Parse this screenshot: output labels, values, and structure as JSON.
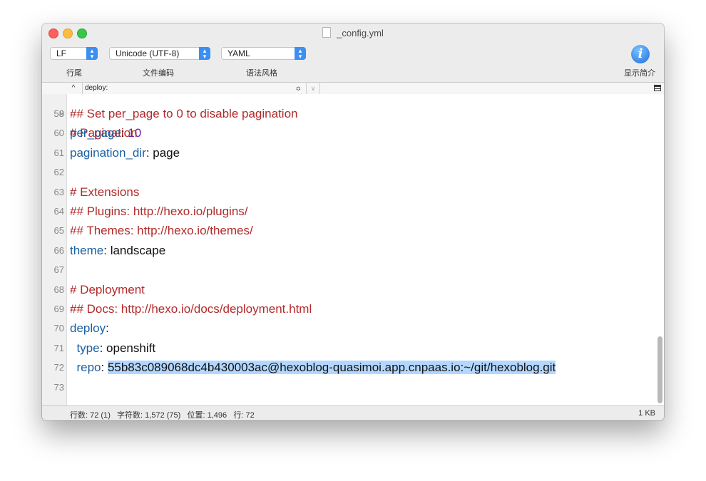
{
  "window": {
    "title": "_config.yml"
  },
  "toolbar": {
    "line_ending": {
      "value": "LF",
      "label": "行尾"
    },
    "encoding": {
      "value": "Unicode (UTF-8)",
      "label": "文件编码"
    },
    "syntax": {
      "value": "YAML",
      "label": "语法风格"
    },
    "info_label": "显示简介"
  },
  "navbar": {
    "up_glyph": "^",
    "section": "deploy:",
    "select_glyph": "≎",
    "down_glyph": "∨"
  },
  "editor": {
    "partial_top": {
      "number": "58",
      "text": "# Pagination"
    },
    "lines": [
      {
        "number": "59",
        "parts": [
          {
            "t": "## Set per_page to 0 to disable pagination",
            "k": "comment"
          }
        ]
      },
      {
        "number": "60",
        "parts": [
          {
            "t": "per_page",
            "k": "key"
          },
          {
            "t": ": ",
            "k": "val"
          },
          {
            "t": "10",
            "k": "num"
          }
        ]
      },
      {
        "number": "61",
        "parts": [
          {
            "t": "pagination_dir",
            "k": "key"
          },
          {
            "t": ": page",
            "k": "val"
          }
        ]
      },
      {
        "number": "62",
        "parts": []
      },
      {
        "number": "63",
        "parts": [
          {
            "t": "# Extensions",
            "k": "comment"
          }
        ]
      },
      {
        "number": "64",
        "parts": [
          {
            "t": "## Plugins: http://hexo.io/plugins/",
            "k": "comment"
          }
        ]
      },
      {
        "number": "65",
        "parts": [
          {
            "t": "## Themes: http://hexo.io/themes/",
            "k": "comment"
          }
        ]
      },
      {
        "number": "66",
        "parts": [
          {
            "t": "theme",
            "k": "key"
          },
          {
            "t": ": landscape",
            "k": "val"
          }
        ]
      },
      {
        "number": "67",
        "parts": []
      },
      {
        "number": "68",
        "parts": [
          {
            "t": "# Deployment",
            "k": "comment"
          }
        ]
      },
      {
        "number": "69",
        "parts": [
          {
            "t": "## Docs: http://hexo.io/docs/deployment.html",
            "k": "comment"
          }
        ]
      },
      {
        "number": "70",
        "parts": [
          {
            "t": "deploy",
            "k": "key"
          },
          {
            "t": ":",
            "k": "val"
          }
        ]
      },
      {
        "number": "71",
        "parts": [
          {
            "t": "  ",
            "k": "val"
          },
          {
            "t": "type",
            "k": "key"
          },
          {
            "t": ": openshift",
            "k": "val"
          }
        ]
      },
      {
        "number": "72",
        "parts": [
          {
            "t": "  ",
            "k": "val"
          },
          {
            "t": "repo",
            "k": "key"
          },
          {
            "t": ": ",
            "k": "val"
          },
          {
            "t": "55b83c089068dc4b430003ac@hexoblog-quasimoi.app.cnpaas.io:~/git/hexoblog.git",
            "k": "sel"
          }
        ]
      },
      {
        "number": "73",
        "parts": []
      }
    ]
  },
  "status": {
    "lines_label": "行数:",
    "lines_value": "72 (1)",
    "chars_label": "字符数:",
    "chars_value": "1,572 (75)",
    "position_label": "位置:",
    "position_value": "1,496",
    "row_label": "行:",
    "row_value": "72",
    "file_size": "1 KB"
  },
  "icons": {
    "document": "document-icon",
    "info": "info-icon",
    "menu": "list-menu-icon"
  },
  "colors": {
    "comment": "#b22a2a",
    "key": "#1a5fa3",
    "number": "#6a1fa8",
    "selection": "#b3d7ff",
    "popup_accent": "#3b8ff0"
  }
}
